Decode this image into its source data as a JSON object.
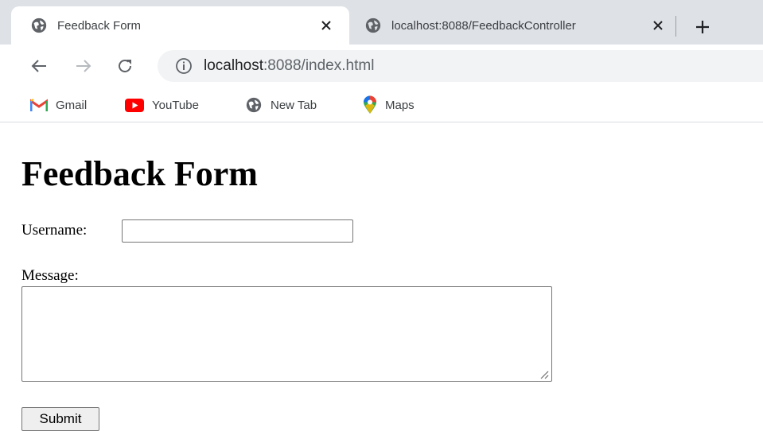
{
  "browser": {
    "tabs": [
      {
        "title": "Feedback Form",
        "icon": "globe-icon",
        "active": true
      },
      {
        "title": "localhost:8088/FeedbackController",
        "icon": "globe-icon",
        "active": false
      }
    ],
    "address_bar": {
      "icon": "info-icon",
      "host": "localhost",
      "rest": ":8088/index.html"
    },
    "bookmarks": [
      {
        "label": "Gmail",
        "icon": "gmail-icon"
      },
      {
        "label": "YouTube",
        "icon": "youtube-icon"
      },
      {
        "label": "New Tab",
        "icon": "globe-icon"
      },
      {
        "label": "Maps",
        "icon": "maps-icon"
      }
    ]
  },
  "page": {
    "heading": "Feedback Form",
    "username_label": "Username:",
    "username_value": "",
    "message_label": "Message:",
    "message_value": "",
    "submit_label": "Submit"
  },
  "colors": {
    "tabstrip": "#dee1e6",
    "omnibox": "#f1f3f4",
    "icon_gray": "#5f6368",
    "youtube_red": "#ff0000",
    "gmail_red": "#ea4335"
  }
}
